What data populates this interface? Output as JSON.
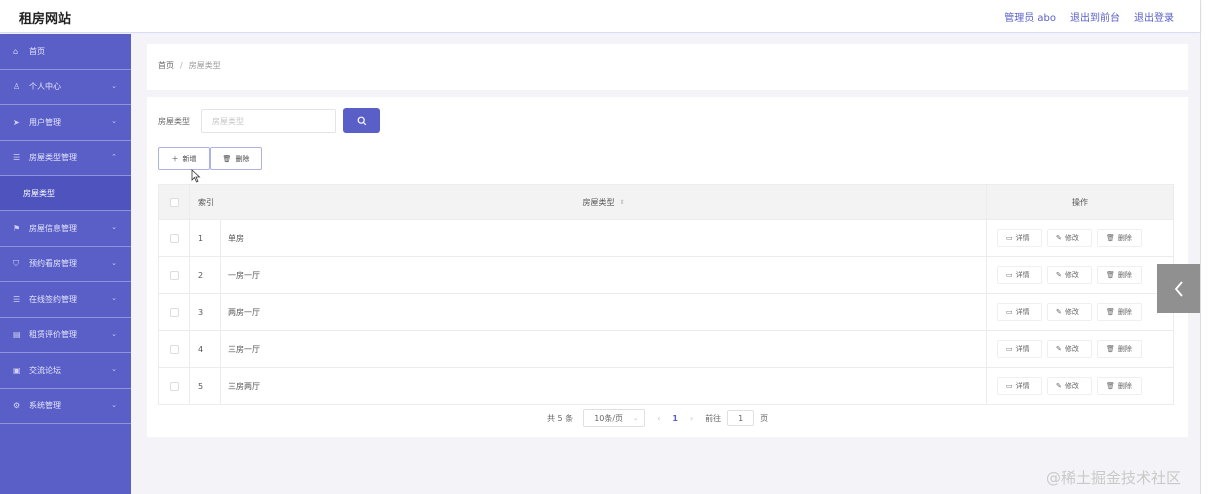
{
  "header": {
    "brand": "租房网站",
    "admin_label": "管理员 abo",
    "to_front_label": "退出到前台",
    "logout_label": "退出登录"
  },
  "sidebar": {
    "items": [
      {
        "label": "首页",
        "icon": "home-icon",
        "chevron": false
      },
      {
        "label": "个人中心",
        "icon": "user-icon",
        "chevron": true
      },
      {
        "label": "用户管理",
        "icon": "send-icon",
        "chevron": true
      },
      {
        "label": "房屋类型管理",
        "icon": "list-icon",
        "chevron": true,
        "expanded": true
      },
      {
        "label": "房屋信息管理",
        "icon": "flag-icon",
        "chevron": true
      },
      {
        "label": "预约看房管理",
        "icon": "shield-icon",
        "chevron": true
      },
      {
        "label": "在线签约管理",
        "icon": "list-icon",
        "chevron": true
      },
      {
        "label": "租赁评价管理",
        "icon": "doc-icon",
        "chevron": true
      },
      {
        "label": "交流论坛",
        "icon": "chat-icon",
        "chevron": true
      },
      {
        "label": "系统管理",
        "icon": "settings-icon",
        "chevron": true
      }
    ],
    "sub_item": "房屋类型"
  },
  "breadcrumb": {
    "home": "首页",
    "separator": "/",
    "current": "房屋类型"
  },
  "search": {
    "label": "房屋类型",
    "placeholder": "房屋类型",
    "value": ""
  },
  "actions": {
    "add_label": "新增",
    "delete_label": "删除"
  },
  "table": {
    "headers": {
      "index": "索引",
      "type": "房屋类型",
      "ops": "操作"
    },
    "rows": [
      {
        "index": "1",
        "type": "单房"
      },
      {
        "index": "2",
        "type": "一房一厅"
      },
      {
        "index": "3",
        "type": "两房一厅"
      },
      {
        "index": "4",
        "type": "三房一厅"
      },
      {
        "index": "5",
        "type": "三房两厅"
      }
    ],
    "row_actions": {
      "detail": "详情",
      "edit": "修改",
      "remove": "删除"
    }
  },
  "pagination": {
    "total": "共 5 条",
    "page_size": "10条/页",
    "current_page": "1",
    "goto_label": "前往",
    "goto_value": "1",
    "page_suffix": "页"
  },
  "watermark": "@稀土掘金技术社区",
  "colors": {
    "accent": "#5a5fc8",
    "sidebar": "#5a5fc8"
  }
}
